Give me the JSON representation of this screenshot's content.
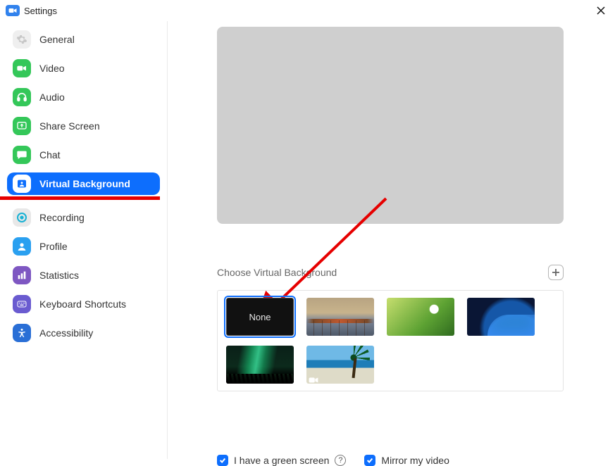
{
  "window": {
    "title": "Settings"
  },
  "sidebar": {
    "items": [
      {
        "label": "General"
      },
      {
        "label": "Video"
      },
      {
        "label": "Audio"
      },
      {
        "label": "Share Screen"
      },
      {
        "label": "Chat"
      },
      {
        "label": "Virtual Background"
      },
      {
        "label": "Recording"
      },
      {
        "label": "Profile"
      },
      {
        "label": "Statistics"
      },
      {
        "label": "Keyboard Shortcuts"
      },
      {
        "label": "Accessibility"
      }
    ],
    "active_index": 5
  },
  "main": {
    "section_title": "Choose Virtual Background",
    "backgrounds": [
      {
        "label": "None",
        "selected": true
      },
      {
        "label": "bridge"
      },
      {
        "label": "grass"
      },
      {
        "label": "earth"
      },
      {
        "label": "aurora",
        "is_video": true
      },
      {
        "label": "beach",
        "is_video": true
      }
    ],
    "checks": {
      "green_screen": {
        "label": "I have a green screen",
        "checked": true
      },
      "mirror": {
        "label": "Mirror my video",
        "checked": true
      }
    }
  },
  "colors": {
    "accent": "#0d6efd",
    "annotation": "#e60000"
  }
}
